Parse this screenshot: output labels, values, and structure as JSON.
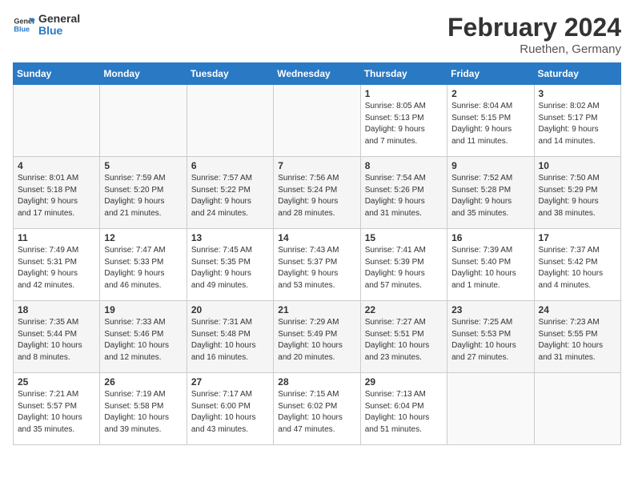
{
  "logo": {
    "line1": "General",
    "line2": "Blue"
  },
  "title": "February 2024",
  "subtitle": "Ruethen, Germany",
  "days_of_week": [
    "Sunday",
    "Monday",
    "Tuesday",
    "Wednesday",
    "Thursday",
    "Friday",
    "Saturday"
  ],
  "weeks": [
    [
      {
        "day": "",
        "info": ""
      },
      {
        "day": "",
        "info": ""
      },
      {
        "day": "",
        "info": ""
      },
      {
        "day": "",
        "info": ""
      },
      {
        "day": "1",
        "info": "Sunrise: 8:05 AM\nSunset: 5:13 PM\nDaylight: 9 hours\nand 7 minutes."
      },
      {
        "day": "2",
        "info": "Sunrise: 8:04 AM\nSunset: 5:15 PM\nDaylight: 9 hours\nand 11 minutes."
      },
      {
        "day": "3",
        "info": "Sunrise: 8:02 AM\nSunset: 5:17 PM\nDaylight: 9 hours\nand 14 minutes."
      }
    ],
    [
      {
        "day": "4",
        "info": "Sunrise: 8:01 AM\nSunset: 5:18 PM\nDaylight: 9 hours\nand 17 minutes."
      },
      {
        "day": "5",
        "info": "Sunrise: 7:59 AM\nSunset: 5:20 PM\nDaylight: 9 hours\nand 21 minutes."
      },
      {
        "day": "6",
        "info": "Sunrise: 7:57 AM\nSunset: 5:22 PM\nDaylight: 9 hours\nand 24 minutes."
      },
      {
        "day": "7",
        "info": "Sunrise: 7:56 AM\nSunset: 5:24 PM\nDaylight: 9 hours\nand 28 minutes."
      },
      {
        "day": "8",
        "info": "Sunrise: 7:54 AM\nSunset: 5:26 PM\nDaylight: 9 hours\nand 31 minutes."
      },
      {
        "day": "9",
        "info": "Sunrise: 7:52 AM\nSunset: 5:28 PM\nDaylight: 9 hours\nand 35 minutes."
      },
      {
        "day": "10",
        "info": "Sunrise: 7:50 AM\nSunset: 5:29 PM\nDaylight: 9 hours\nand 38 minutes."
      }
    ],
    [
      {
        "day": "11",
        "info": "Sunrise: 7:49 AM\nSunset: 5:31 PM\nDaylight: 9 hours\nand 42 minutes."
      },
      {
        "day": "12",
        "info": "Sunrise: 7:47 AM\nSunset: 5:33 PM\nDaylight: 9 hours\nand 46 minutes."
      },
      {
        "day": "13",
        "info": "Sunrise: 7:45 AM\nSunset: 5:35 PM\nDaylight: 9 hours\nand 49 minutes."
      },
      {
        "day": "14",
        "info": "Sunrise: 7:43 AM\nSunset: 5:37 PM\nDaylight: 9 hours\nand 53 minutes."
      },
      {
        "day": "15",
        "info": "Sunrise: 7:41 AM\nSunset: 5:39 PM\nDaylight: 9 hours\nand 57 minutes."
      },
      {
        "day": "16",
        "info": "Sunrise: 7:39 AM\nSunset: 5:40 PM\nDaylight: 10 hours\nand 1 minute."
      },
      {
        "day": "17",
        "info": "Sunrise: 7:37 AM\nSunset: 5:42 PM\nDaylight: 10 hours\nand 4 minutes."
      }
    ],
    [
      {
        "day": "18",
        "info": "Sunrise: 7:35 AM\nSunset: 5:44 PM\nDaylight: 10 hours\nand 8 minutes."
      },
      {
        "day": "19",
        "info": "Sunrise: 7:33 AM\nSunset: 5:46 PM\nDaylight: 10 hours\nand 12 minutes."
      },
      {
        "day": "20",
        "info": "Sunrise: 7:31 AM\nSunset: 5:48 PM\nDaylight: 10 hours\nand 16 minutes."
      },
      {
        "day": "21",
        "info": "Sunrise: 7:29 AM\nSunset: 5:49 PM\nDaylight: 10 hours\nand 20 minutes."
      },
      {
        "day": "22",
        "info": "Sunrise: 7:27 AM\nSunset: 5:51 PM\nDaylight: 10 hours\nand 23 minutes."
      },
      {
        "day": "23",
        "info": "Sunrise: 7:25 AM\nSunset: 5:53 PM\nDaylight: 10 hours\nand 27 minutes."
      },
      {
        "day": "24",
        "info": "Sunrise: 7:23 AM\nSunset: 5:55 PM\nDaylight: 10 hours\nand 31 minutes."
      }
    ],
    [
      {
        "day": "25",
        "info": "Sunrise: 7:21 AM\nSunset: 5:57 PM\nDaylight: 10 hours\nand 35 minutes."
      },
      {
        "day": "26",
        "info": "Sunrise: 7:19 AM\nSunset: 5:58 PM\nDaylight: 10 hours\nand 39 minutes."
      },
      {
        "day": "27",
        "info": "Sunrise: 7:17 AM\nSunset: 6:00 PM\nDaylight: 10 hours\nand 43 minutes."
      },
      {
        "day": "28",
        "info": "Sunrise: 7:15 AM\nSunset: 6:02 PM\nDaylight: 10 hours\nand 47 minutes."
      },
      {
        "day": "29",
        "info": "Sunrise: 7:13 AM\nSunset: 6:04 PM\nDaylight: 10 hours\nand 51 minutes."
      },
      {
        "day": "",
        "info": ""
      },
      {
        "day": "",
        "info": ""
      }
    ]
  ]
}
